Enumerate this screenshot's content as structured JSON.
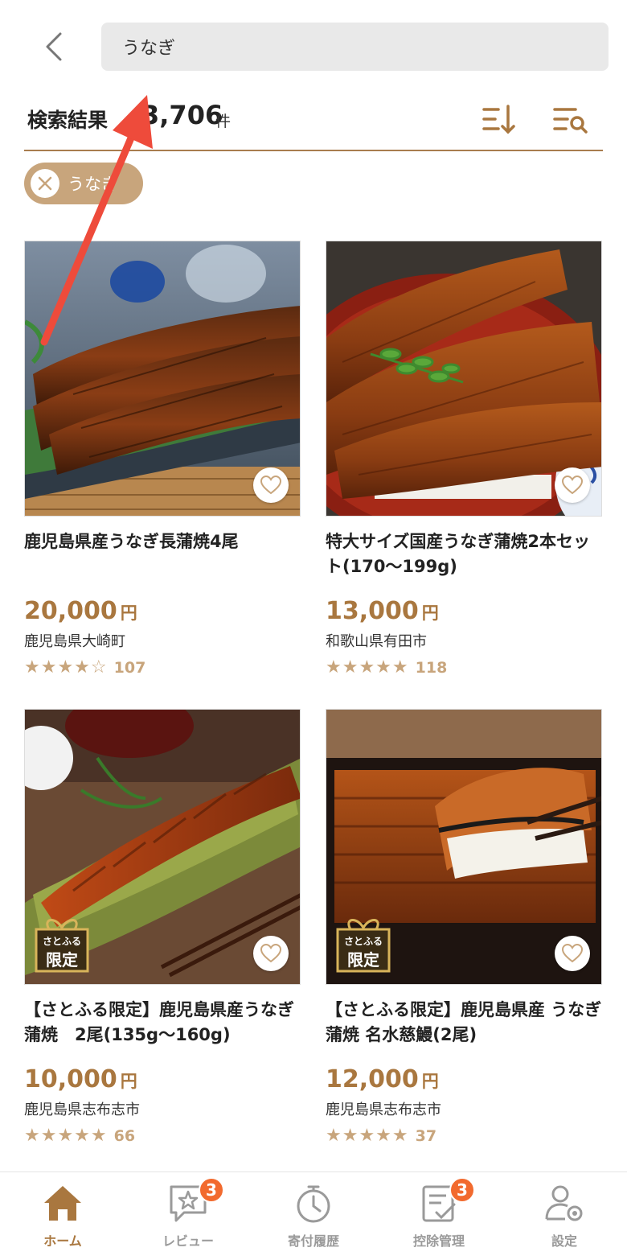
{
  "search": {
    "query": "うなぎ"
  },
  "results": {
    "label": "検索結果",
    "count": "3,706",
    "unit": "件"
  },
  "filter_chip": {
    "label": "うなぎ"
  },
  "products": [
    {
      "title": "鹿児島県産うなぎ長蒲焼4尾",
      "price": "20,000",
      "yen": "円",
      "town": "鹿児島県大崎町",
      "stars": "★★★★☆",
      "review_count": "107",
      "limited": false
    },
    {
      "title": "特大サイズ国産うなぎ蒲焼2本セット(170〜199g)",
      "price": "13,000",
      "yen": "円",
      "town": "和歌山県有田市",
      "stars": "★★★★★",
      "review_count": "118",
      "limited": false
    },
    {
      "title": "【さとふる限定】鹿児島県産うなぎ蒲焼　2尾(135g〜160g)",
      "price": "10,000",
      "yen": "円",
      "town": "鹿児島県志布志市",
      "stars": "★★★★★",
      "review_count": "66",
      "limited": true,
      "badge": [
        "さとふる",
        "限定"
      ]
    },
    {
      "title": "【さとふる限定】鹿児島県産 うなぎ蒲焼 名水慈鰻(2尾)",
      "price": "12,000",
      "yen": "円",
      "town": "鹿児島県志布志市",
      "stars": "★★★★★",
      "review_count": "37",
      "limited": true,
      "badge": [
        "さとふる",
        "限定"
      ]
    }
  ],
  "tabbar": {
    "items": [
      {
        "label": "ホーム",
        "icon": "home-icon",
        "active": true
      },
      {
        "label": "レビュー",
        "icon": "review-icon",
        "badge": "3"
      },
      {
        "label": "寄付履歴",
        "icon": "history-icon"
      },
      {
        "label": "控除管理",
        "icon": "deduction-icon",
        "badge": "3"
      },
      {
        "label": "設定",
        "icon": "settings-icon"
      }
    ]
  },
  "colors": {
    "accent": "#a9773f",
    "chip": "#c8a57c",
    "notification": "#f26a2e",
    "annotation_arrow": "#ee4b3b"
  }
}
